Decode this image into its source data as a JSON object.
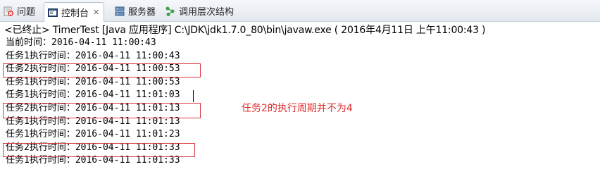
{
  "tabs": [
    {
      "label": "问题",
      "icon": "problems-icon",
      "active": false
    },
    {
      "label": "控制台",
      "icon": "console-icon",
      "active": true,
      "close": "✕"
    },
    {
      "label": "服务器",
      "icon": "servers-icon",
      "active": false
    },
    {
      "label": "调用层次结构",
      "icon": "call-hierarchy-icon",
      "active": false
    }
  ],
  "console_header": "<已终止> TimerTest [Java 应用程序] C:\\JDK\\jdk1.7.0_80\\bin\\javaw.exe ( 2016年4月11日 上午11:00:43 )",
  "log_lines": [
    "当前时间：2016-04-11 11:00:43",
    "任务1执行时间：2016-04-11 11:00:43",
    "任务2执行时间：2016-04-11 11:00:53",
    "任务1执行时间：2016-04-11 11:00:53",
    "任务1执行时间：2016-04-11 11:01:03",
    "任务2执行时间：2016-04-11 11:01:13",
    "任务1执行时间：2016-04-11 11:01:13",
    "任务1执行时间：2016-04-11 11:01:23",
    "任务2执行时间：2016-04-11 11:01:33",
    "任务1执行时间：2016-04-11 11:01:33"
  ],
  "annotation": "任务2的执行周期并不为4",
  "colors": {
    "highlight_box": "#d9363e",
    "annotation_text": "#e03030"
  }
}
